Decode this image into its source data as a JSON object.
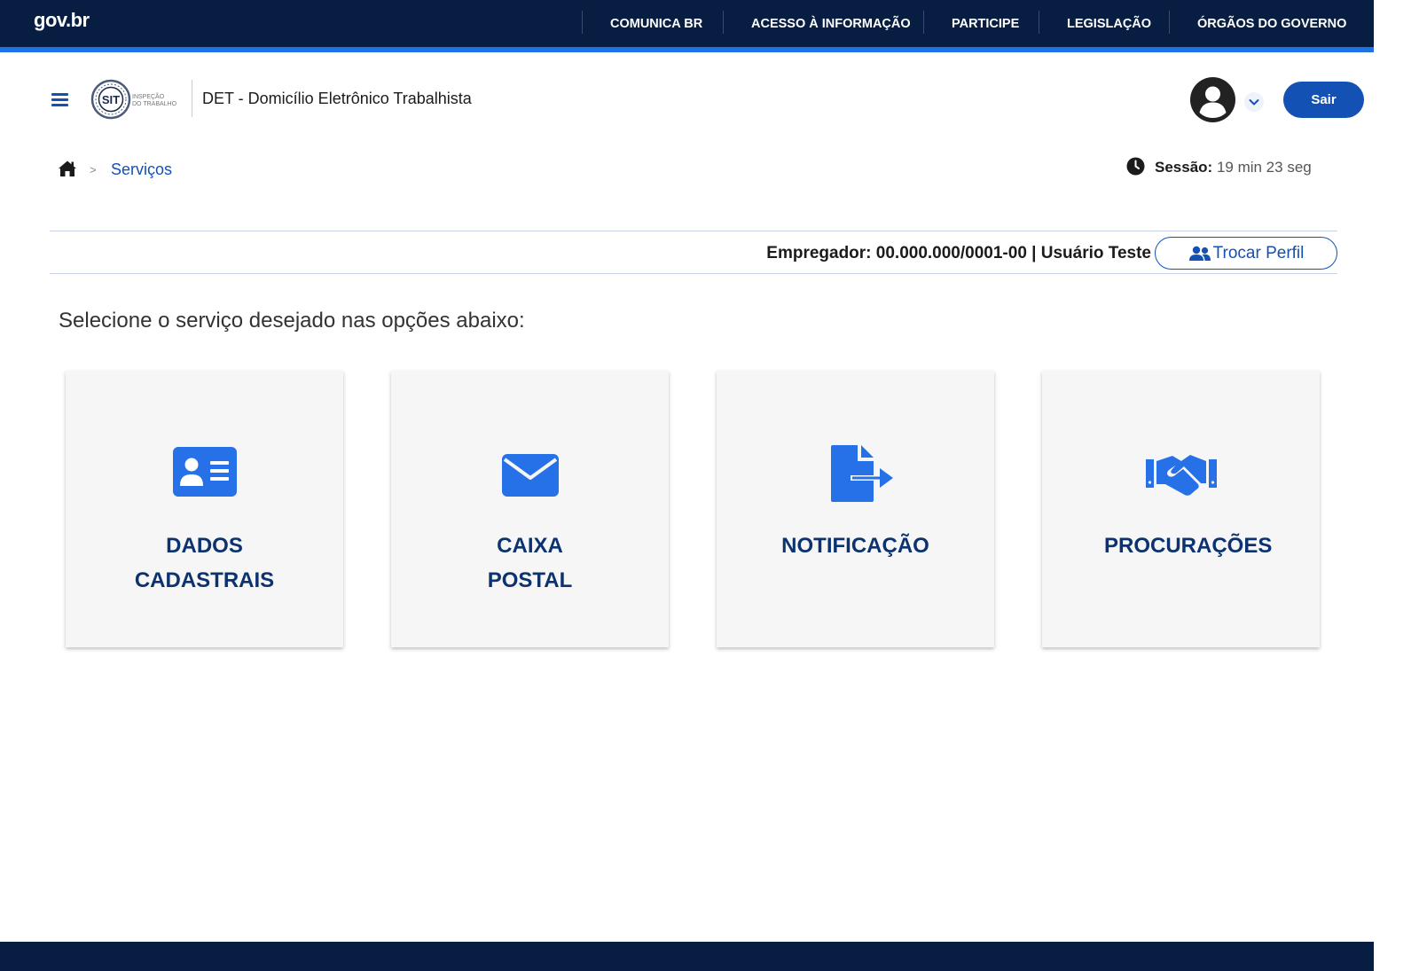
{
  "gov_bar": {
    "logo": "gov.br",
    "links": [
      "COMUNICA BR",
      "ACESSO À INFORMAÇÃO",
      "PARTICIPE",
      "LEGISLAÇÃO",
      "ÓRGÃOS DO GOVERNO"
    ]
  },
  "header": {
    "logo_acronym": "SIT",
    "logo_text_line1": "INSPEÇÃO",
    "logo_text_line2": "DO TRABALHO",
    "title": "DET - Domicílio Eletrônico Trabalhista",
    "logout_label": "Sair"
  },
  "breadcrumb": {
    "current": "Serviços",
    "separator": ">"
  },
  "session": {
    "label": "Sessão:",
    "remaining": "19 min 23 seg"
  },
  "profile": {
    "employer_text": "Empregador: 00.000.000/0001-00 | Usuário Teste",
    "switch_label": "Trocar Perfil"
  },
  "intro": "Selecione o serviço desejado nas opções abaixo:",
  "services": [
    {
      "label": "DADOS CADASTRAIS",
      "icon": "id-card-icon"
    },
    {
      "label": "CAIXA POSTAL",
      "icon": "envelope-icon"
    },
    {
      "label": "NOTIFICAÇÃO",
      "icon": "file-export-icon"
    },
    {
      "label": "PROCURAÇÕES",
      "icon": "handshake-icon"
    }
  ],
  "colors": {
    "gov_navy": "#071d41",
    "gov_blue": "#1351b4",
    "icon_blue": "#2670e8",
    "card_label": "#0c326f"
  }
}
